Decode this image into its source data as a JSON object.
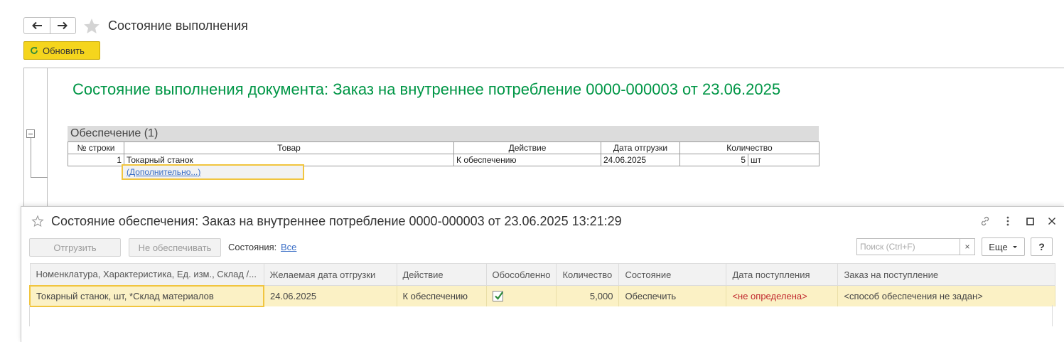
{
  "window": {
    "title": "Состояние выполнения",
    "refresh_label": "Обновить"
  },
  "report": {
    "title": "Состояние выполнения документа: Заказ на внутреннее потребление 0000-000003 от 23.06.2025",
    "group_title": "Обеспечение (1)",
    "columns": [
      "№ строки",
      "Товар",
      "Действие",
      "Дата отгрузки",
      "Количество"
    ],
    "row": {
      "line": "1",
      "product": "Токарный станок",
      "action": "К обеспечению",
      "date": "24.06.2025",
      "qty": "5",
      "unit": "шт"
    },
    "extra_link": "(Дополнительно...)"
  },
  "modal": {
    "title": "Состояние обеспечения: Заказ на внутреннее потребление 0000-000003 от 23.06.2025 13:21:29",
    "ship_label": "Отгрузить",
    "not_provide_label": "Не обеспечивать",
    "states_label": "Состояния:",
    "states_value": "Все",
    "search_placeholder": "Поиск (Ctrl+F)",
    "search_clear": "×",
    "more_label": "Еще",
    "help_label": "?",
    "columns": [
      "Номенклатура, Характеристика, Ед. изм., Склад /...",
      "Желаемая дата отгрузки",
      "Действие",
      "Обособленно",
      "Количество",
      "Состояние",
      "Дата поступления",
      "Заказ на поступление"
    ],
    "row": {
      "item": "Токарный станок, шт, *Склад материалов",
      "date": "24.06.2025",
      "action": "К обеспечению",
      "separate": true,
      "qty": "5,000",
      "state": "Обеспечить",
      "arrival": "<не определена>",
      "order": "<способ обеспечения не задан>"
    }
  },
  "colors": {
    "accent_green": "#009646",
    "yellow_button": "#f5d51d",
    "selection_border": "#f1c53f",
    "row_highlight": "#fbf1c5",
    "link": "#3a6ec6",
    "warning_red": "#c0282d"
  },
  "icons": [
    "back-arrow-icon",
    "forward-arrow-icon",
    "favorite-star-icon",
    "refresh-icon",
    "link-icon",
    "more-vertical-icon",
    "maximize-icon",
    "close-icon",
    "checkmark-icon",
    "dropdown-arrow-icon"
  ]
}
